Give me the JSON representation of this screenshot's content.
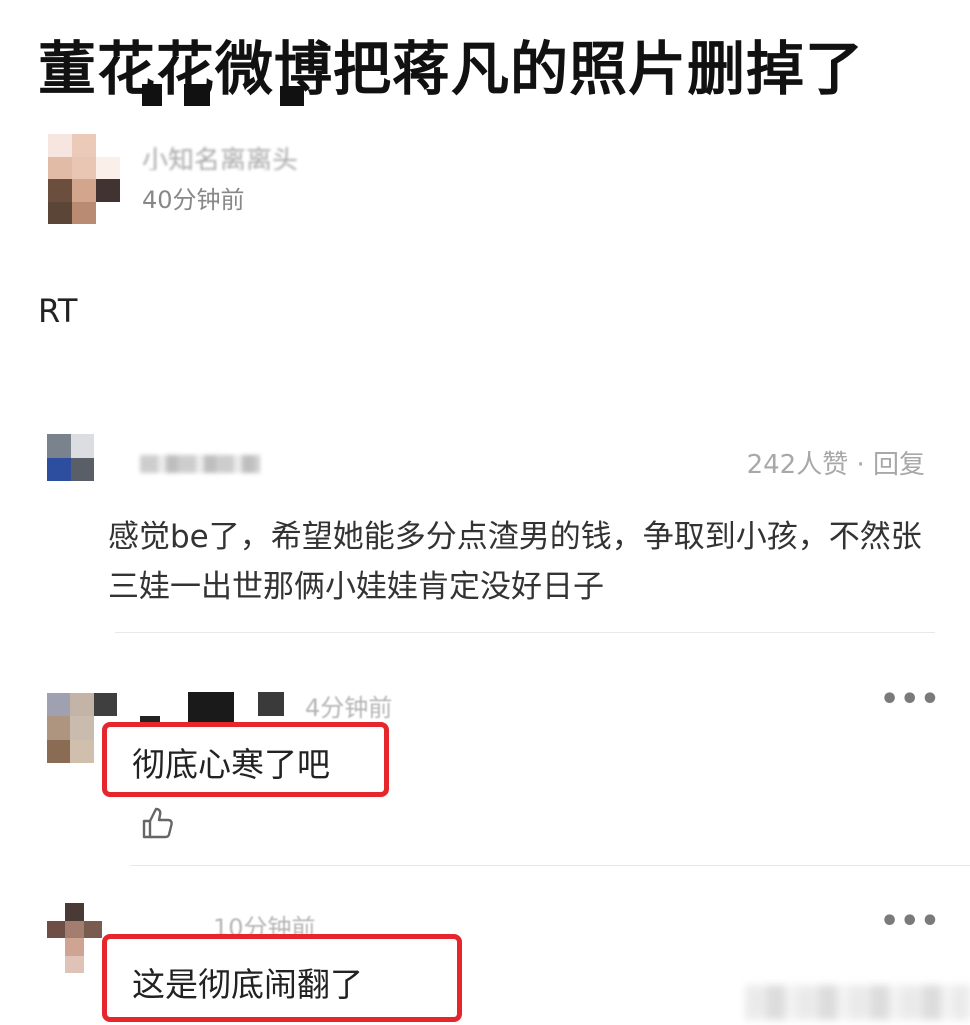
{
  "post": {
    "title": "董花花微博把蒋凡的照片删掉了",
    "author_name": "小知名离离头",
    "time": "40分钟前",
    "body": "RT"
  },
  "comments": [
    {
      "meta": "242人赞 · 回复",
      "text": "感觉be了，希望她能多分点渣男的钱，争取到小孩，不然张三娃一出世那俩小娃娃肯定没好日子"
    },
    {
      "time": "4分钟前",
      "text": "彻底心寒了吧",
      "more": "•••",
      "like_icon": "thumbs-up-icon"
    },
    {
      "time": "10分钟前",
      "text": "这是彻底闹翻了",
      "more": "•••"
    }
  ],
  "colors": {
    "highlight": "#e5262c",
    "muted_text": "#a8a8a8",
    "body_text": "#222222"
  }
}
